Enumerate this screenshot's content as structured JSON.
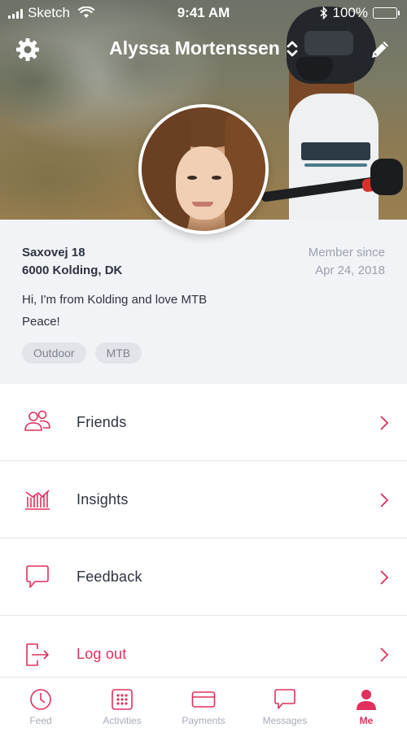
{
  "status_bar": {
    "carrier": "Sketch",
    "time": "9:41 AM",
    "battery": "100%"
  },
  "header": {
    "title": "Alyssa Mortenssen",
    "icons": {
      "left": "gear-icon",
      "title_toggle": "sort-arrows-icon",
      "right": "pencil-icon"
    }
  },
  "profile": {
    "address_line1": "Saxovej 18",
    "address_line2": "6000 Kolding, DK",
    "member_since_label": "Member since",
    "member_since_date": "Apr 24, 2018",
    "bio_line1": "Hi, I'm from Kolding and love MTB",
    "bio_line2": "Peace!",
    "tags": [
      "Outdoor",
      "MTB"
    ]
  },
  "menu": [
    {
      "label": "Friends",
      "icon": "friends-icon"
    },
    {
      "label": "Insights",
      "icon": "chart-icon"
    },
    {
      "label": "Feedback",
      "icon": "speech-bubble-icon"
    },
    {
      "label": "Log out",
      "icon": "logout-icon"
    }
  ],
  "tabs": [
    {
      "label": "Feed",
      "icon": "clock-icon",
      "active": false
    },
    {
      "label": "Activities",
      "icon": "grid-icon",
      "active": false
    },
    {
      "label": "Payments",
      "icon": "card-icon",
      "active": false
    },
    {
      "label": "Messages",
      "icon": "message-icon",
      "active": false
    },
    {
      "label": "Me",
      "icon": "person-icon",
      "active": true
    }
  ],
  "colors": {
    "accent": "#e0305c",
    "text": "#2d3340",
    "muted": "#9aa1ad",
    "info_bg": "#f2f3f6"
  }
}
